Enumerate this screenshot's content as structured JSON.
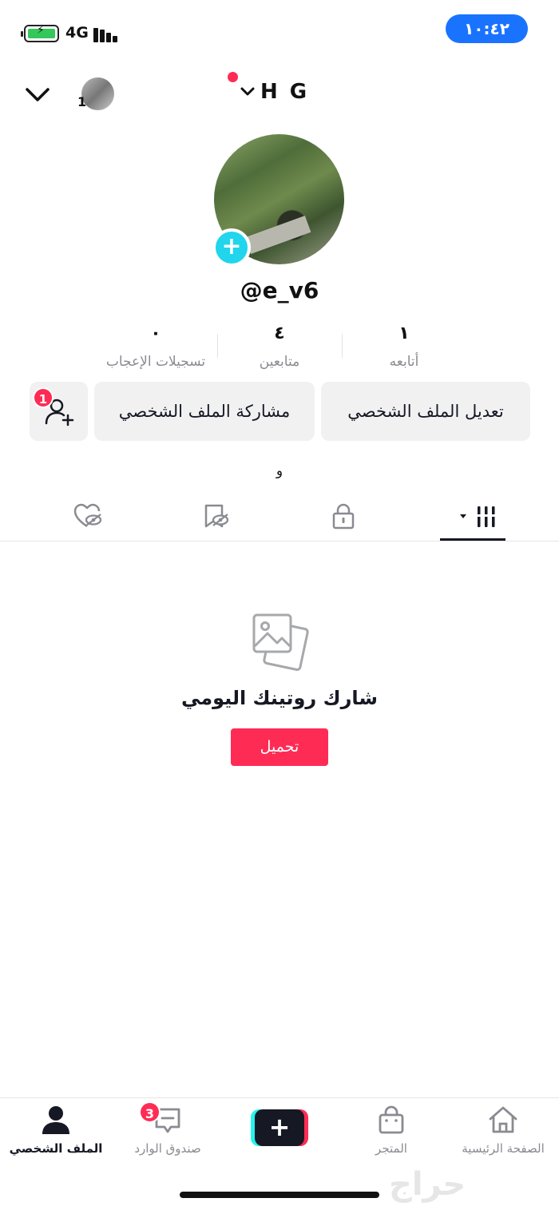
{
  "status_bar": {
    "network": "4G",
    "time": "١٠:٤٢",
    "battery_color": "#34c759",
    "time_pill_color": "#1a73ff"
  },
  "header": {
    "account_count": "1",
    "title": "H G",
    "notification_dot_color": "#fe2c55"
  },
  "profile": {
    "handle": "@e_v6",
    "add_photo_icon": "plus-icon"
  },
  "stats": [
    {
      "value": "١",
      "label": "أتابعه"
    },
    {
      "value": "٤",
      "label": "متابعين"
    },
    {
      "value": "٠",
      "label": "تسجيلات الإعجاب"
    }
  ],
  "actions": {
    "edit_profile": "تعديل الملف الشخصي",
    "share_profile": "مشاركة الملف الشخصي",
    "add_friends_badge": "1"
  },
  "bio": "و",
  "tabs": [
    {
      "name": "videos",
      "icon": "grid-icon",
      "active": true
    },
    {
      "name": "private",
      "icon": "lock-icon",
      "active": false
    },
    {
      "name": "reposts",
      "icon": "hidden-bookmark-icon",
      "active": false
    },
    {
      "name": "liked",
      "icon": "hidden-heart-icon",
      "active": false
    }
  ],
  "empty_state": {
    "icon": "photos-icon",
    "title": "شارك روتينك اليومي",
    "button": "تحميل"
  },
  "bottom_nav": {
    "home": "الصفحة الرئيسية",
    "shop": "المتجر",
    "create_icon": "plus-icon",
    "inbox": "صندوق الوارد",
    "inbox_badge": "3",
    "profile": "الملف الشخصي"
  },
  "watermark": "حراج",
  "colors": {
    "accent": "#fe2c55",
    "cyan": "#25f4ee",
    "text": "#161823",
    "muted": "#8a8b91"
  }
}
